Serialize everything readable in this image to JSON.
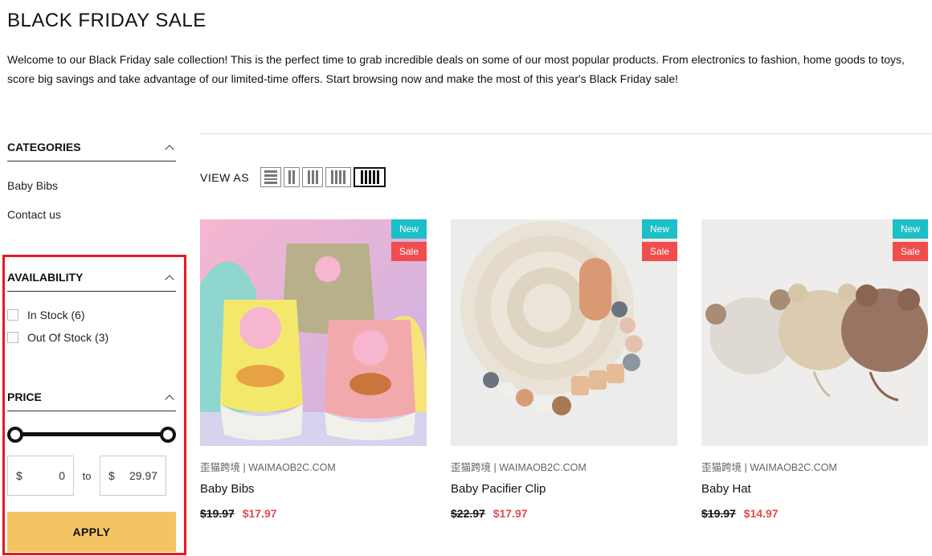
{
  "page": {
    "title": "BLACK FRIDAY SALE",
    "intro": "Welcome to our Black Friday sale collection! This is the perfect time to grab incredible deals on some of our most popular products. From electronics to fashion, home goods to toys, score big savings and take advantage of our limited-time offers. Start browsing now and make the most of this year's Black Friday sale!"
  },
  "sidebar": {
    "categories": {
      "title": "CATEGORIES",
      "items": [
        "Baby Bibs",
        "Contact us"
      ]
    },
    "availability": {
      "title": "AVAILABILITY",
      "options": [
        {
          "label": "In Stock (6)",
          "checked": false
        },
        {
          "label": "Out Of Stock (3)",
          "checked": false
        }
      ]
    },
    "price": {
      "title": "PRICE",
      "currency": "$",
      "min": "0",
      "max": "29.97",
      "separator": "to",
      "apply_label": "APPLY"
    }
  },
  "main": {
    "view_as_label": "VIEW AS",
    "view_options": [
      "list",
      "2-column",
      "3-column",
      "4-column",
      "5-column"
    ],
    "active_view": "5-column",
    "products": [
      {
        "vendor": "歪猫跨境 | WAIMAOB2C.COM",
        "name": "Baby Bibs",
        "old_price": "$19.97",
        "price": "$17.97",
        "badges": [
          "New",
          "Sale"
        ]
      },
      {
        "vendor": "歪猫跨境 | WAIMAOB2C.COM",
        "name": "Baby Pacifier Clip",
        "old_price": "$22.97",
        "price": "$17.97",
        "badges": [
          "New",
          "Sale"
        ]
      },
      {
        "vendor": "歪猫跨境 | WAIMAOB2C.COM",
        "name": "Baby Hat",
        "old_price": "$19.97",
        "price": "$14.97",
        "badges": [
          "New",
          "Sale"
        ]
      }
    ]
  },
  "colors": {
    "highlight": "#e31b23",
    "badge_new": "#1bbfc7",
    "badge_sale": "#f04e4e",
    "sale_price": "#e34c4c",
    "apply_button": "#f5c462"
  }
}
